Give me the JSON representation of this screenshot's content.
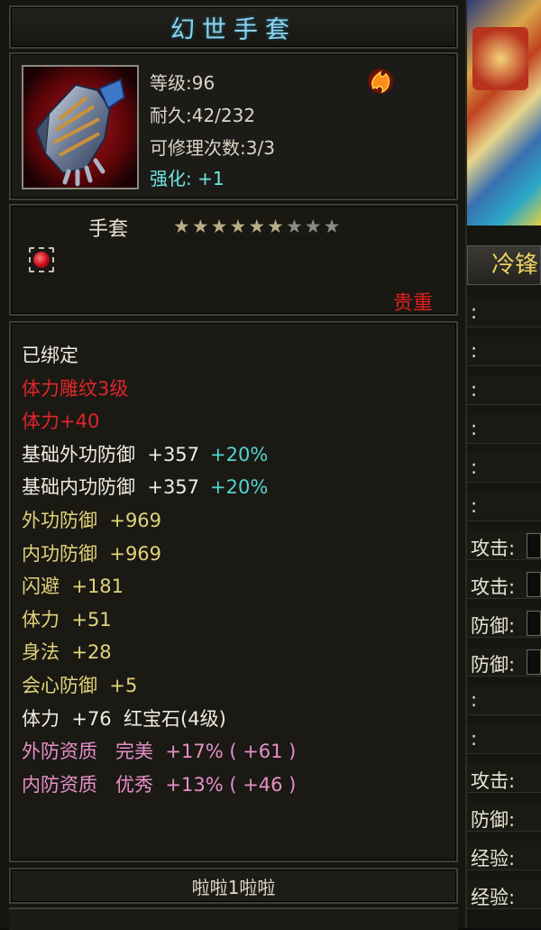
{
  "tooltip": {
    "title": "幻世手套",
    "stats": {
      "level": "等级:96",
      "durability": "耐久:42/232",
      "repairs": "可修理次数:3/3",
      "enhance": "强化: +1"
    },
    "type": "手套",
    "stars_total": 9,
    "stars_filled": 6,
    "rarity": "贵重",
    "attributes": [
      {
        "text": "已绑定",
        "color": "white"
      },
      {
        "text": "体力雕纹3级",
        "color": "red"
      },
      {
        "text": "体力+40",
        "color": "red"
      },
      {
        "text": "基础外功防御  +357",
        "extra": "+20%",
        "color": "white"
      },
      {
        "text": "基础内功防御  +357",
        "extra": "+20%",
        "color": "white"
      },
      {
        "text": "外功防御  +969",
        "color": "gold"
      },
      {
        "text": "内功防御  +969",
        "color": "gold"
      },
      {
        "text": "闪避  +181",
        "color": "gold"
      },
      {
        "text": "体力  +51",
        "color": "gold"
      },
      {
        "text": "身法  +28",
        "color": "gold"
      },
      {
        "text": "会心防御  +5",
        "color": "gold"
      },
      {
        "text": "体力  +76  红宝石(4级)",
        "color": "white"
      },
      {
        "text": "外防资质   完美  +17% ( +61 )",
        "color": "pink"
      },
      {
        "text": "内防资质   优秀  +13% ( +46 )",
        "color": "pink"
      }
    ],
    "owner": "啦啦1啦啦"
  },
  "side_panel": {
    "tab_label": "冷锋",
    "rows": [
      ":",
      ":",
      ":",
      ":",
      ":",
      ":",
      "攻击:",
      "攻击:",
      "防御:",
      "防御:",
      ":",
      ":",
      "攻击:",
      "防御:",
      "经验:",
      "经验:"
    ]
  }
}
